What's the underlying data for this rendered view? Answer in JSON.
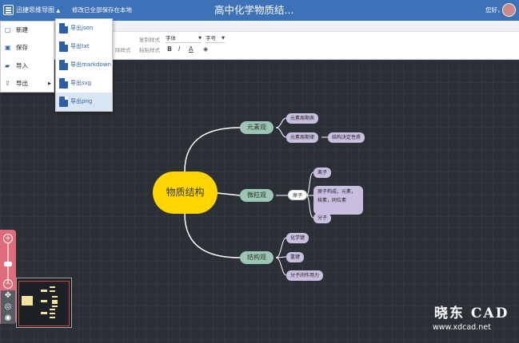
{
  "topbar": {
    "app_name": "迅捷思维导图",
    "save_status": "修改已全部保存在本地",
    "title": "高中化学物质结...",
    "greeting": "您好，"
  },
  "toolbar": {
    "font_label": "字体",
    "size_label": "字号",
    "copy_style": "复制样式",
    "paste_style": "粘贴样式",
    "clear_style": "除样式",
    "bold": "B",
    "italic": "I",
    "font_color": "A",
    "fill_color": "◈"
  },
  "menu": {
    "items": [
      {
        "label": "新建",
        "icon": "new-file-icon"
      },
      {
        "label": "保存",
        "icon": "save-icon"
      },
      {
        "label": "导入",
        "icon": "folder-open-icon"
      },
      {
        "label": "导出",
        "icon": "export-icon"
      }
    ],
    "export_submenu": [
      "导出json",
      "导出txt",
      "导出markdown",
      "导出svg",
      "导出png"
    ]
  },
  "mindmap": {
    "root": "物质结构",
    "branches": [
      {
        "label": "元素观",
        "children": [
          "元素周期表",
          "元素周期律"
        ],
        "extra": "结构决定性质"
      },
      {
        "label": "微粒观",
        "child": "原子",
        "grandchildren": [
          "离子",
          "原子构成，元素，核素，同位素",
          "分子"
        ]
      },
      {
        "label": "结构观",
        "children": [
          "化学键",
          "氢键",
          "分子间作用力"
        ]
      }
    ]
  },
  "watermark": {
    "logo": "晓东 CAD",
    "url": "www.xdcad.net"
  },
  "colors": {
    "topbar": "#3d72b8",
    "root_node": "#ffd500",
    "main_node": "#9cc5b3",
    "leaf_node": "#c8bfe0",
    "zoom_panel": "#e06b7a"
  }
}
